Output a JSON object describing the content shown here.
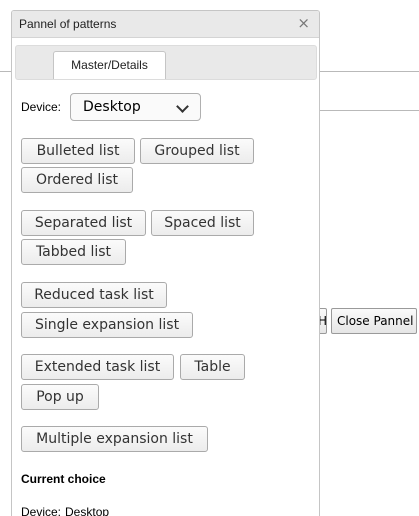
{
  "background": {
    "partial_button_label": "H",
    "close_panel_label": "Close Pannel"
  },
  "panel": {
    "title": "Pannel of patterns",
    "close_glyph": "×",
    "tab_label": "Master/Details",
    "device_label": "Device:",
    "device_value": "Desktop",
    "button_groups": [
      [
        "Bulleted list",
        "Grouped list",
        "Ordered list"
      ],
      [
        "Separated list",
        "Spaced list",
        "Tabbed list"
      ],
      [
        "Reduced task list",
        "Single expansion list"
      ],
      [
        "Extended task list",
        "Table",
        "Pop up"
      ],
      [
        "Multiple expansion list"
      ]
    ],
    "current_choice_title": "Current choice",
    "current_device_label": "Device:",
    "current_device_value": "Desktop"
  }
}
